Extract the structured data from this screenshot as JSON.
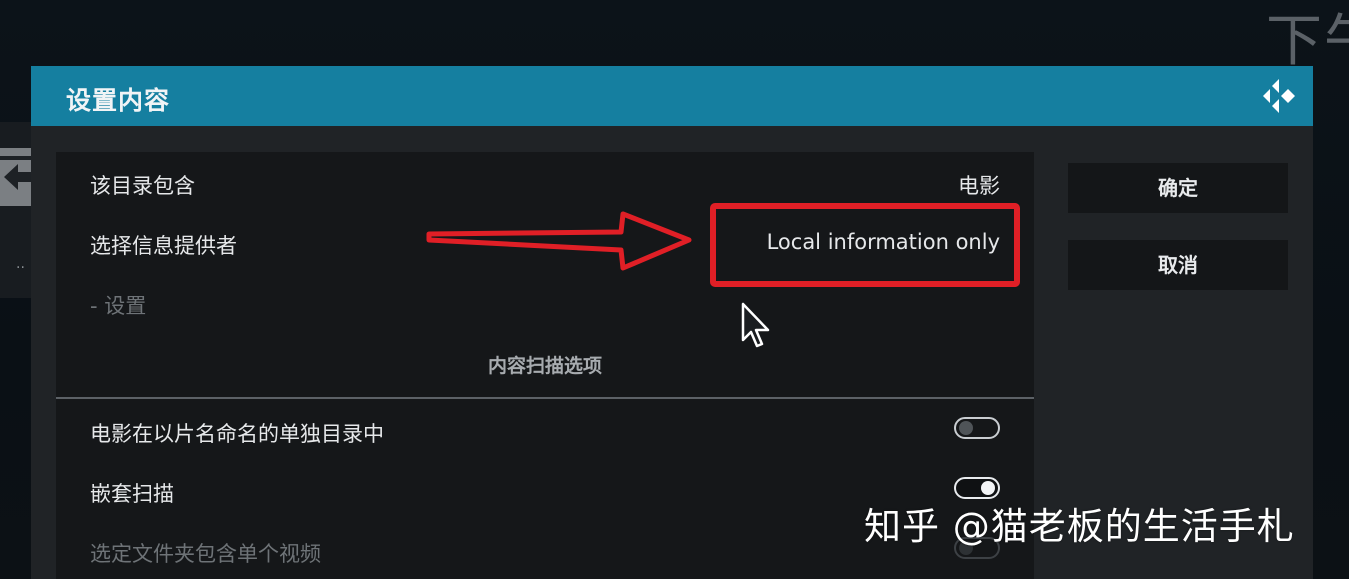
{
  "background": {
    "clock_fragment": "下午",
    "left_dots": ".."
  },
  "dialog": {
    "title": "设置内容",
    "logo_icon": "kodi-logo-icon",
    "header_color": "#157fa0",
    "rows": [
      {
        "label": "该目录包含",
        "value": "电影"
      },
      {
        "label": "选择信息提供者",
        "value": "Local information only"
      },
      {
        "label": "- 设置",
        "value": ""
      }
    ],
    "section_title": "内容扫描选项",
    "options": [
      {
        "label": "电影在以片名命名的单独目录中",
        "state": "off"
      },
      {
        "label": "嵌套扫描",
        "state": "on"
      },
      {
        "label": "选定文件夹包含单个视频",
        "state": "disabled"
      }
    ],
    "buttons": {
      "ok": "确定",
      "cancel": "取消"
    }
  },
  "annotations": {
    "highlight_color": "#e01f26"
  },
  "watermark": "知乎 @猫老板的生活手札"
}
